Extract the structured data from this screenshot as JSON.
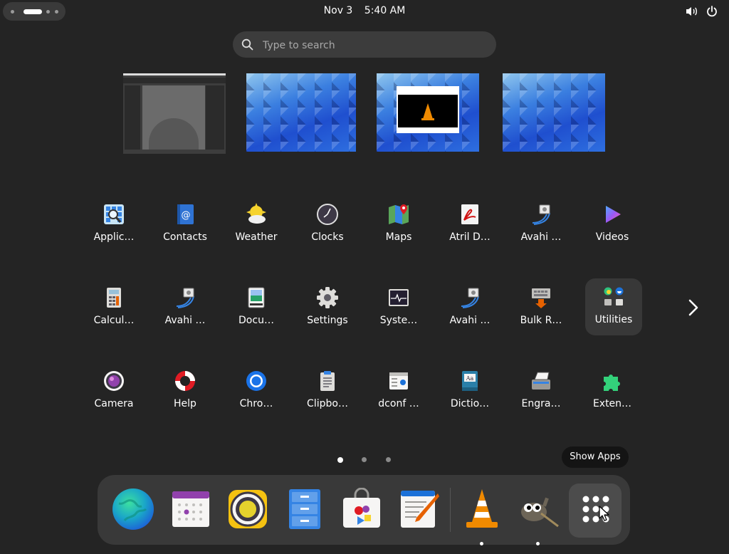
{
  "topbar": {
    "date": "Nov 3",
    "time": "5:40 AM"
  },
  "search": {
    "placeholder": "Type to search"
  },
  "workspaces": [
    {
      "name": "GIMP workspace"
    },
    {
      "name": "empty workspace"
    },
    {
      "name": "VLC workspace"
    },
    {
      "name": "empty workspace"
    }
  ],
  "apps": {
    "row1": [
      {
        "label": "Applic…"
      },
      {
        "label": "Contacts"
      },
      {
        "label": "Weather"
      },
      {
        "label": "Clocks"
      },
      {
        "label": "Maps"
      },
      {
        "label": "Atril D…"
      },
      {
        "label": "Avahi …"
      },
      {
        "label": "Videos"
      }
    ],
    "row2": [
      {
        "label": "Calcul…"
      },
      {
        "label": "Avahi …"
      },
      {
        "label": "Docu…"
      },
      {
        "label": "Settings"
      },
      {
        "label": "Syste…"
      },
      {
        "label": "Avahi …"
      },
      {
        "label": "Bulk R…"
      },
      {
        "label": "Utilities"
      }
    ],
    "row3": [
      {
        "label": "Camera"
      },
      {
        "label": "Help"
      },
      {
        "label": "Chro…"
      },
      {
        "label": "Clipbo…"
      },
      {
        "label": "dconf …"
      },
      {
        "label": "Dictio…"
      },
      {
        "label": "Engra…"
      },
      {
        "label": "Exten…"
      }
    ]
  },
  "pager": {
    "pages": 3,
    "current": 1
  },
  "tooltip": {
    "text": "Show Apps"
  },
  "colors": {
    "background": "#242424",
    "dock": "#393939",
    "accent_blue": "#3584e4"
  }
}
